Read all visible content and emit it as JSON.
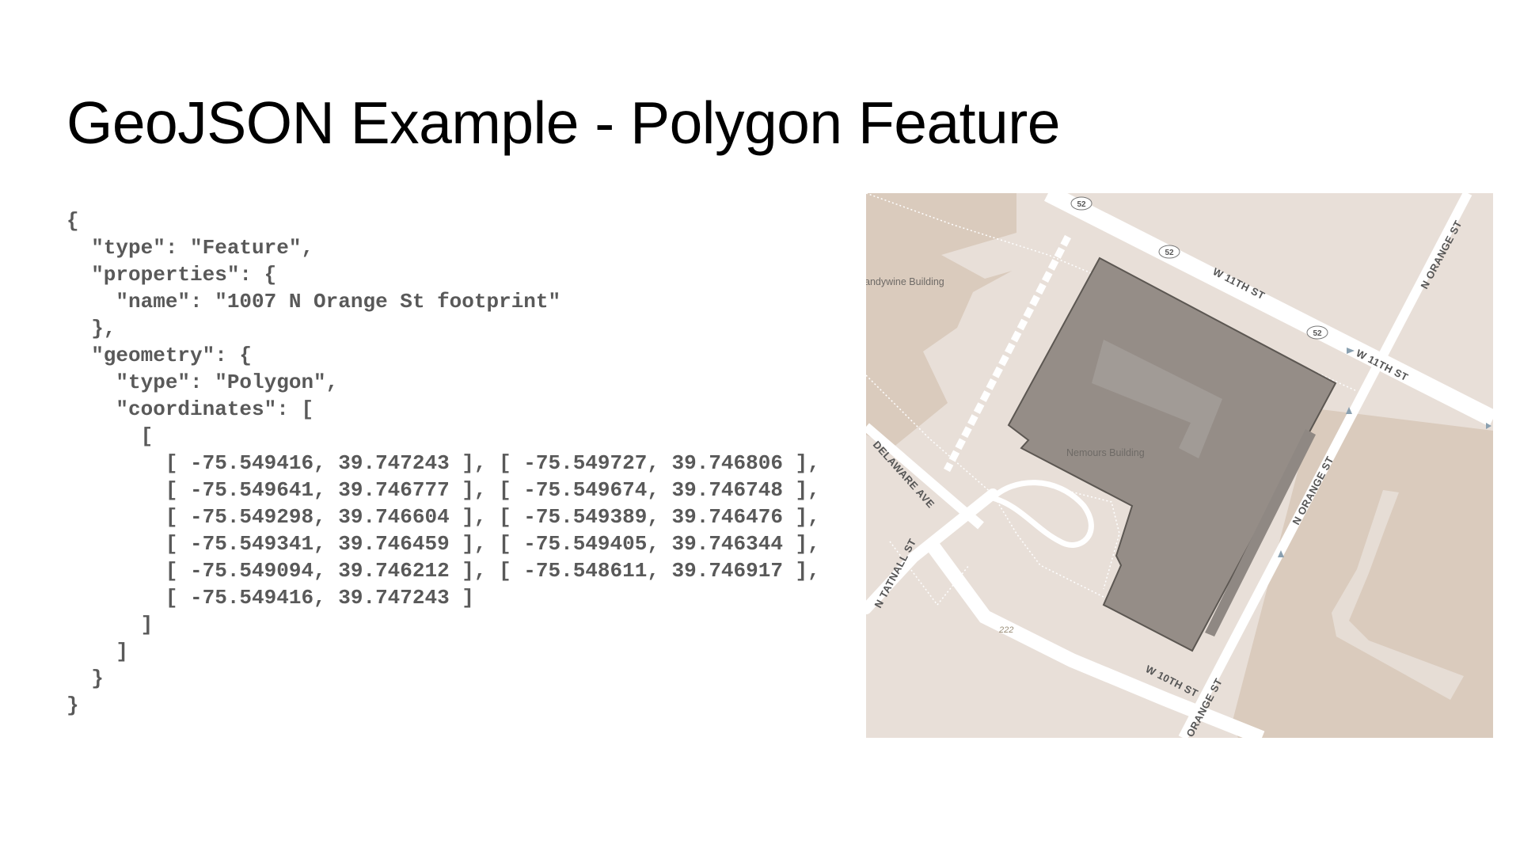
{
  "slide": {
    "title": "GeoJSON Example - Polygon Feature"
  },
  "code": {
    "lines": [
      "{",
      "  \"type\": \"Feature\",",
      "  \"properties\": {",
      "    \"name\": \"1007 N Orange St footprint\"",
      "  },",
      "  \"geometry\": {",
      "    \"type\": \"Polygon\",",
      "    \"coordinates\": [",
      "      [",
      "        [ -75.549416, 39.747243 ], [ -75.549727, 39.746806 ],",
      "        [ -75.549641, 39.746777 ], [ -75.549674, 39.746748 ],",
      "        [ -75.549298, 39.746604 ], [ -75.549389, 39.746476 ],",
      "        [ -75.549341, 39.746459 ], [ -75.549405, 39.746344 ],",
      "        [ -75.549094, 39.746212 ], [ -75.548611, 39.746917 ],",
      "        [ -75.549416, 39.747243 ]",
      "      ]",
      "    ]",
      "  }",
      "}"
    ]
  },
  "map": {
    "labels": {
      "w11th_a": "W 11TH ST",
      "w11th_b": "W 11TH ST",
      "w10th": "W 10TH ST",
      "delaware": "DELAWARE AVE",
      "tatnall": "N TATNALL ST",
      "orange_top": "N ORANGE ST",
      "orange_mid": "N ORANGE ST",
      "orange_bottom": "ORANGE ST",
      "nemours": "Nemours Building",
      "brandywine": "andywine Building",
      "route_shield": "52",
      "lot_number": "222"
    },
    "colors": {
      "background": "#e8dfd8",
      "building_block": "#dacbbd",
      "road": "#ffffff",
      "polygon_fill": "#958d87",
      "polygon_stroke": "#5c5752"
    },
    "icons": [
      "route-52-shield-icon",
      "oneway-arrow-icon"
    ]
  }
}
